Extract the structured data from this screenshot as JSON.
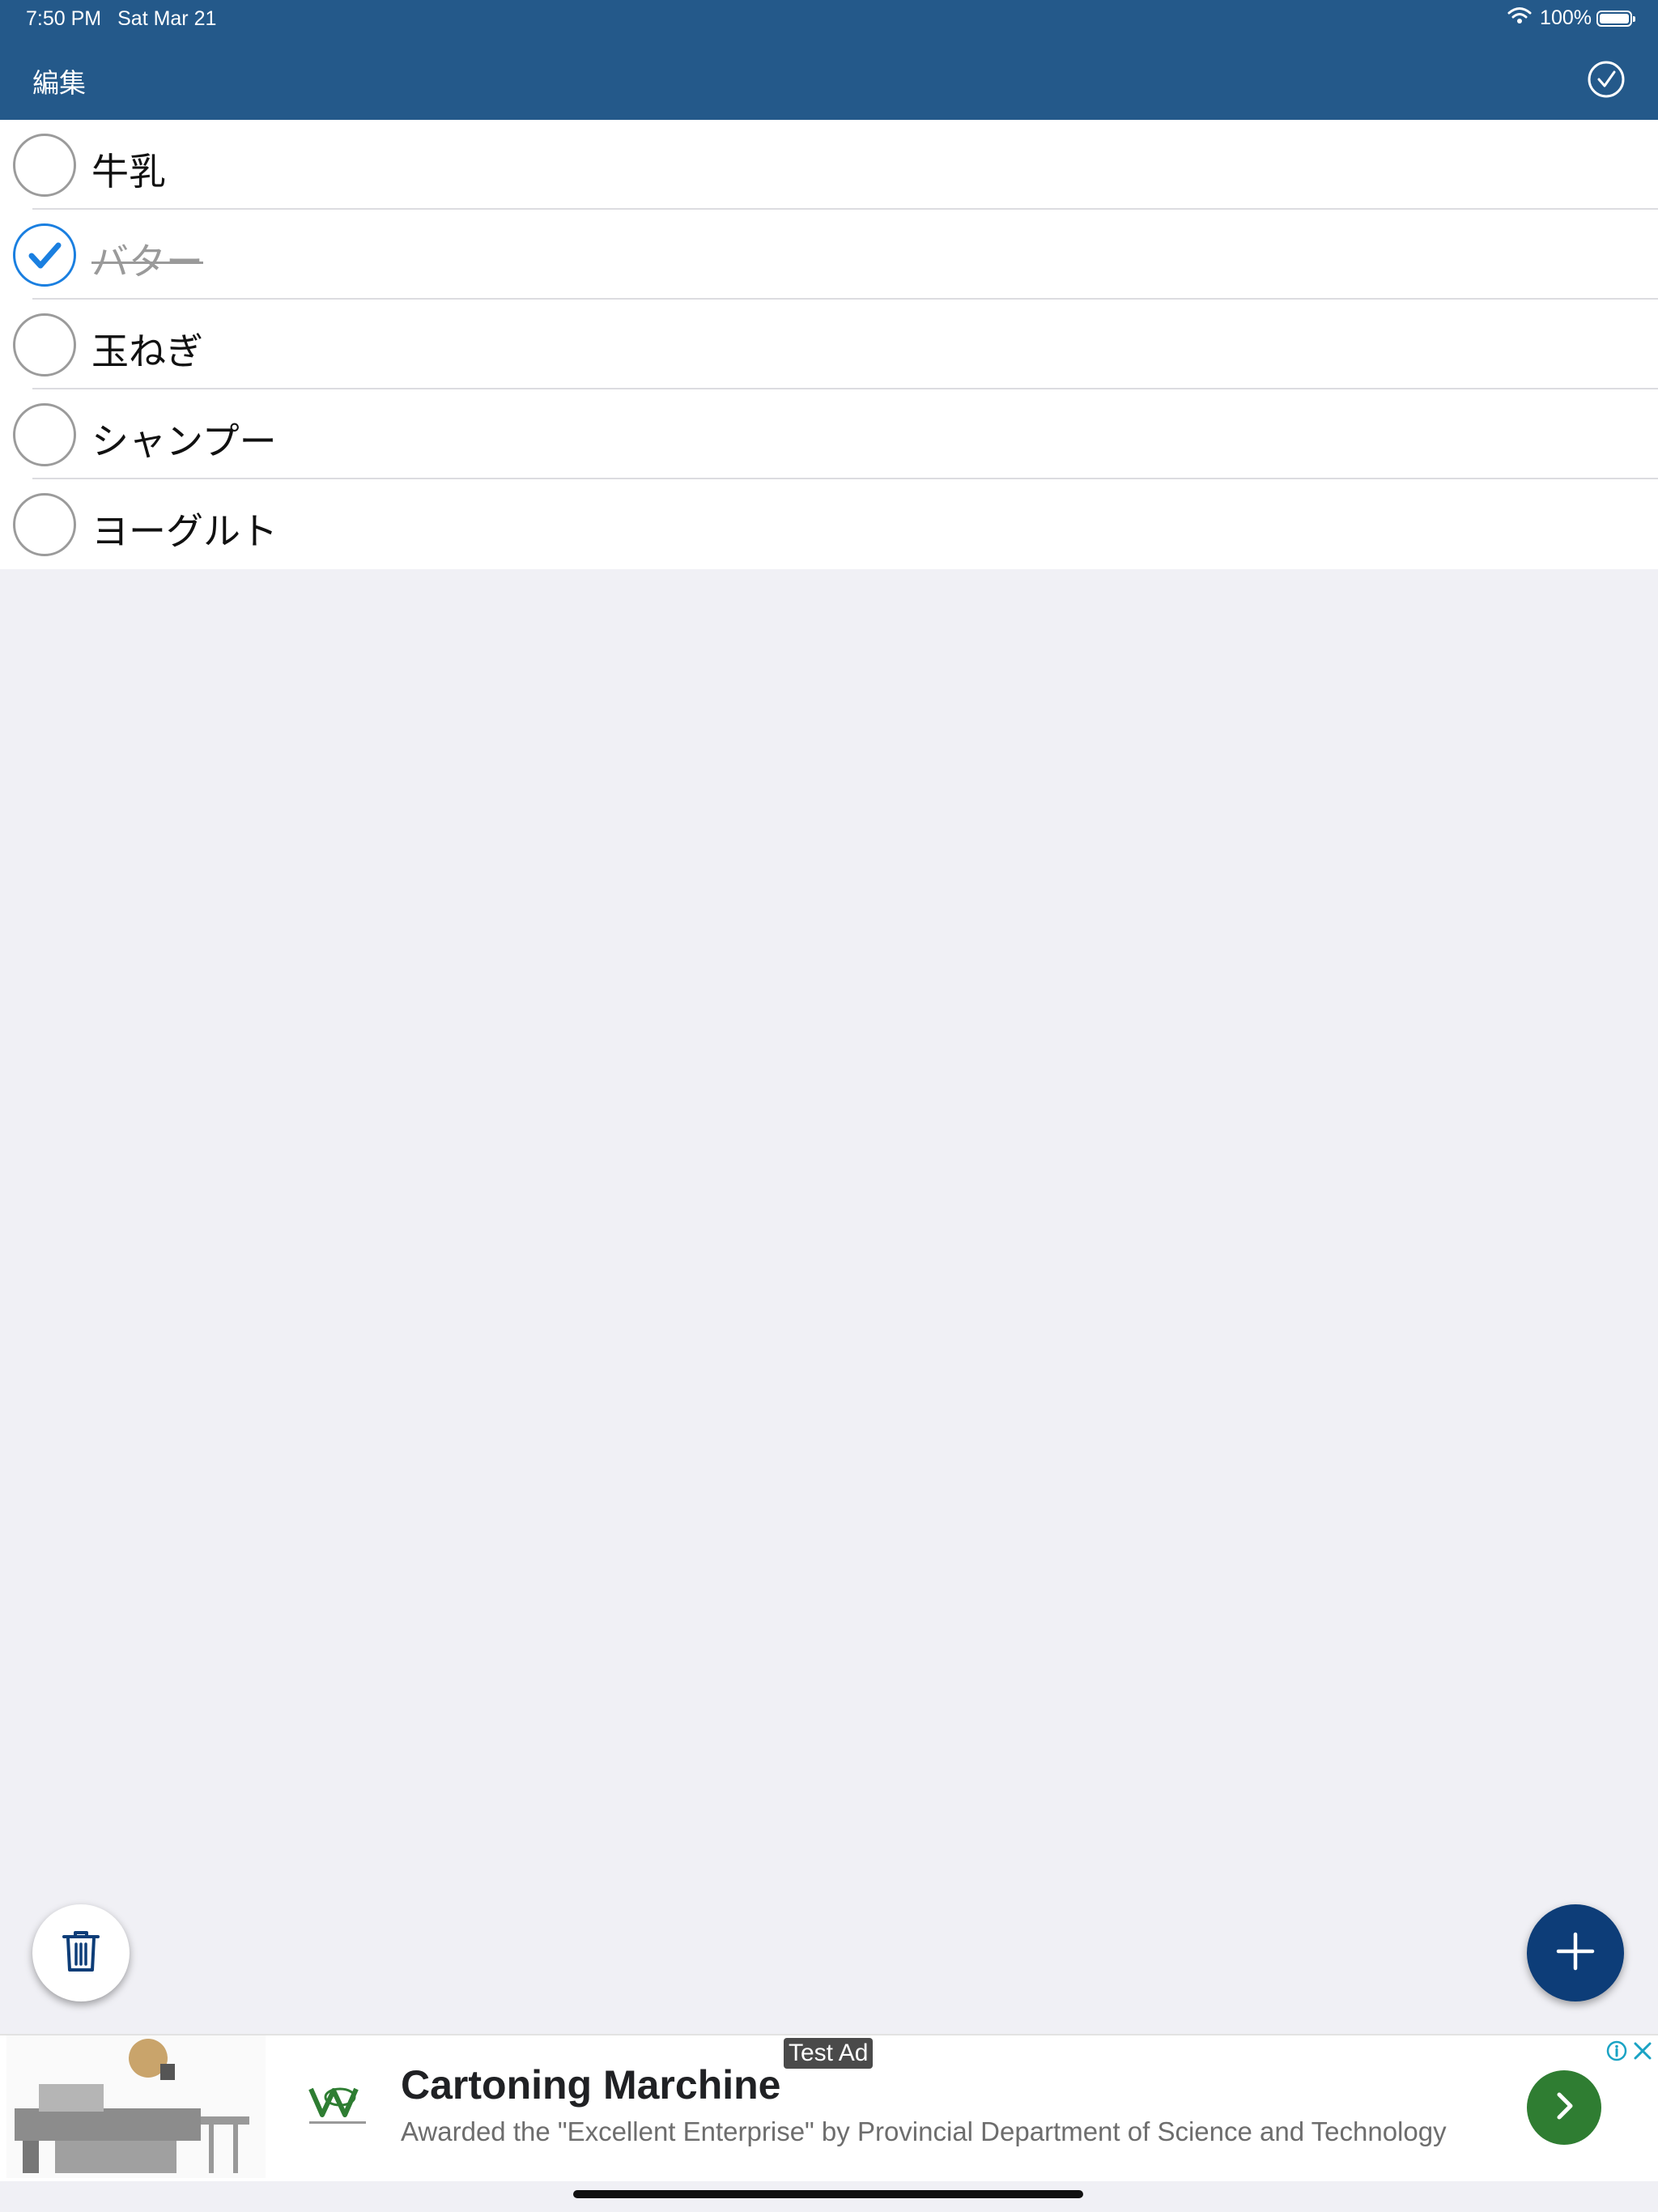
{
  "status_bar": {
    "time": "7:50 PM",
    "date": "Sat Mar 21",
    "battery": "100%",
    "battery_level": 1.0
  },
  "nav": {
    "edit_label": "編集",
    "done_icon": "checkmark-circle-icon"
  },
  "items": [
    {
      "label": "牛乳",
      "checked": false
    },
    {
      "label": "バター",
      "checked": true
    },
    {
      "label": "玉ねぎ",
      "checked": false
    },
    {
      "label": "シャンプー",
      "checked": false
    },
    {
      "label": "ヨーグルト",
      "checked": false
    }
  ],
  "actions": {
    "delete_icon": "trash-icon",
    "add_icon": "plus-icon"
  },
  "ad": {
    "tag": "Test Ad",
    "headline": "Cartoning Marchine",
    "description": "Awarded the \"Excellent Enterprise\" by Provincial Department of Science and Technology",
    "cta_icon": "chevron-right-icon"
  },
  "colors": {
    "nav_bar": "#24598a",
    "check_accent": "#1a7fe0",
    "add_button": "#0d3d78",
    "ad_cta": "#2f7d32",
    "background": "#f0f0f5"
  }
}
